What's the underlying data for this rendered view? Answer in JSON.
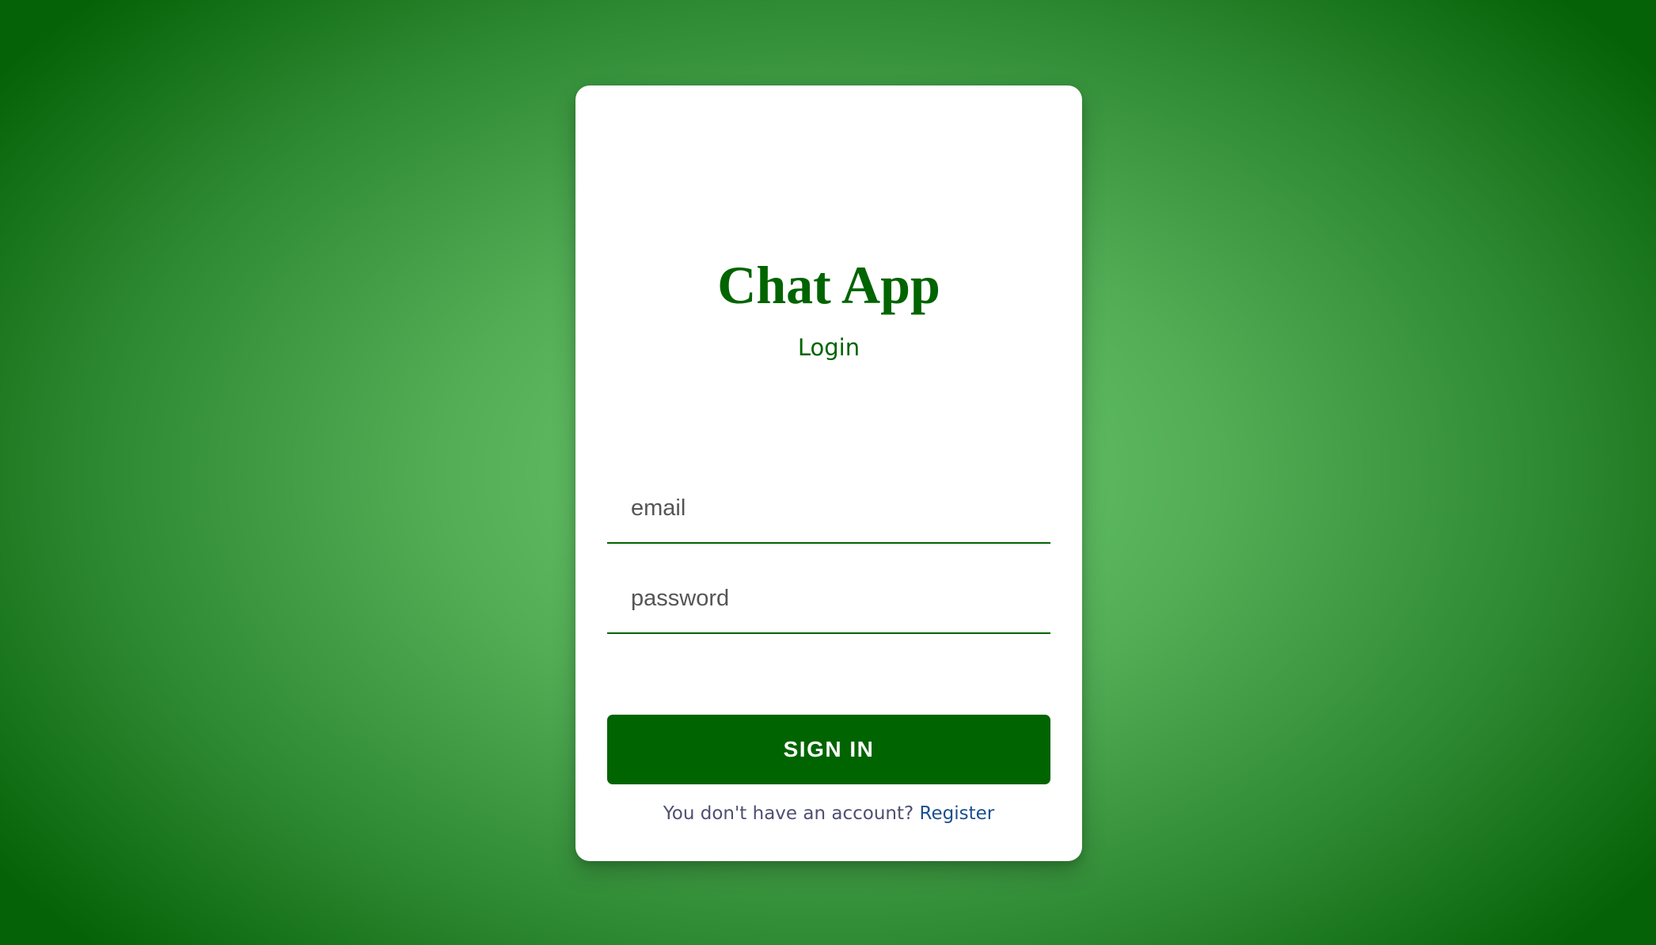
{
  "app": {
    "title": "Chat App",
    "subtitle": "Login"
  },
  "form": {
    "email_placeholder": "email",
    "password_placeholder": "password",
    "signin_label": "SIGN IN"
  },
  "footer": {
    "prompt": "You don't have an account?",
    "register_label": "Register"
  },
  "colors": {
    "brand": "#006400",
    "link": "#1b4f8f",
    "card": "#ffffff"
  }
}
